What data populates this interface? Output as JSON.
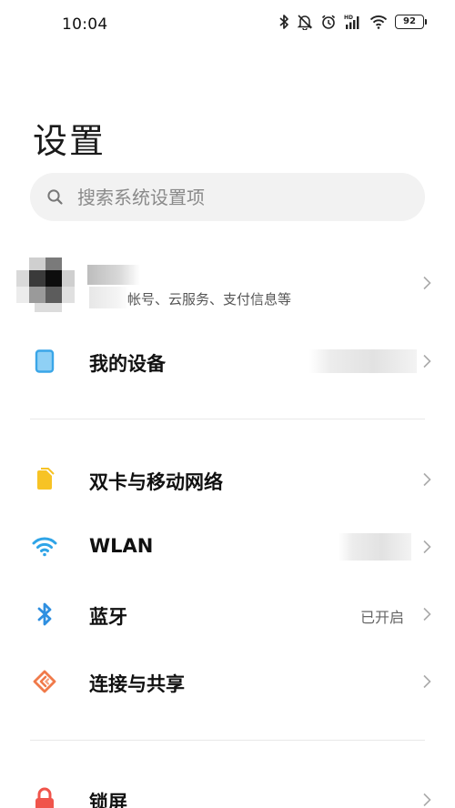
{
  "status_bar": {
    "time": "10:04",
    "network_label": "HD",
    "battery": "92",
    "icons": [
      "bluetooth-icon",
      "mute-icon",
      "alarm-icon",
      "hd-signal-icon",
      "wifi-icon",
      "battery-icon"
    ]
  },
  "page": {
    "title": "设置"
  },
  "search": {
    "placeholder": "搜索系统设置项"
  },
  "account": {
    "subtitle": "帐号、云服务、支付信息等"
  },
  "items": [
    {
      "label": "我的设备",
      "value": "",
      "icon": "phone-device-icon",
      "color": "#3aa6e8"
    },
    {
      "label": "双卡与移动网络",
      "value": "",
      "icon": "sim-card-icon",
      "color": "#f7c325"
    },
    {
      "label": "WLAN",
      "value": "",
      "icon": "wifi-icon",
      "color": "#2fa4e7"
    },
    {
      "label": "蓝牙",
      "value": "已开启",
      "icon": "bluetooth-icon",
      "color": "#2f8fe0"
    },
    {
      "label": "连接与共享",
      "value": "",
      "icon": "share-connection-icon",
      "color": "#f07a4a"
    },
    {
      "label": "锁屏",
      "value": "",
      "icon": "lock-icon",
      "color": "#f0544b"
    }
  ]
}
